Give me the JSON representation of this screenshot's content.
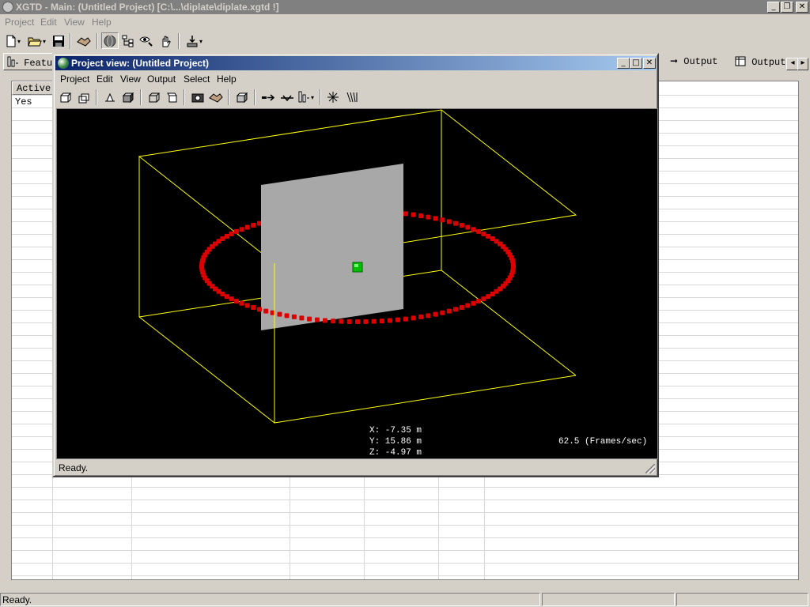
{
  "main": {
    "title": "XGTD - Main: (Untitled Project) [C:\\...\\diplate\\diplate.xgtd !]",
    "menu": [
      "Project",
      "Edit",
      "View",
      "Help"
    ],
    "tabs": {
      "features": "Featur",
      "output1": "Output",
      "output2": "Output"
    },
    "grid": {
      "headers": [
        "Active"
      ],
      "rows": [
        [
          "Yes"
        ]
      ]
    },
    "status": "Ready."
  },
  "project_view": {
    "title": "Project view: (Untitled Project)",
    "menu": [
      "Project",
      "Edit",
      "View",
      "Output",
      "Select",
      "Help"
    ],
    "readout": {
      "x": "X: -7.35 m",
      "y": "Y: 15.86 m",
      "z": "Z: -4.97 m",
      "fps": "62.5 (Frames/sec)"
    },
    "status": "Ready."
  },
  "colors": {
    "active_title_start": "#0a246a",
    "active_title_end": "#a6caf0",
    "bounding_box": "#ffff00",
    "plate": "#a8a8a8",
    "ring": "#dd0000",
    "marker": "#00c000"
  },
  "icons": {
    "app": "xgtd-globe-icon",
    "minimize": "minimize-icon",
    "maximize": "maximize-icon",
    "restore": "restore-icon",
    "close": "close-icon"
  }
}
